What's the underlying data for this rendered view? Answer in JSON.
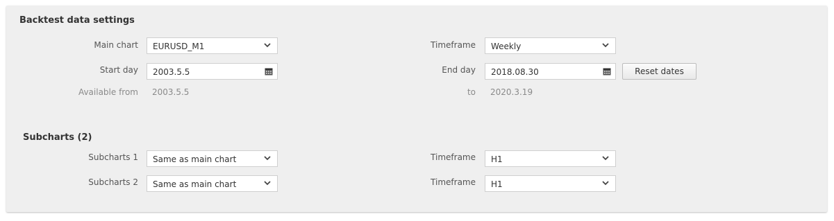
{
  "backtest": {
    "title": "Backtest data settings",
    "main_chart_label": "Main chart",
    "main_chart_value": "EURUSD_M1",
    "timeframe_label": "Timeframe",
    "timeframe_value": "Weekly",
    "start_day_label": "Start day",
    "start_day_value": "2003.5.5",
    "end_day_label": "End day",
    "end_day_value": "2018.08.30",
    "reset_dates_label": "Reset dates",
    "available_from_label": "Available from",
    "available_from_value": "2003.5.5",
    "to_label": "to",
    "to_value": "2020.3.19"
  },
  "subcharts": {
    "title": "Subcharts (2)",
    "rows": [
      {
        "label": "Subcharts 1",
        "value": "Same as main chart",
        "timeframe_label": "Timeframe",
        "timeframe_value": "H1"
      },
      {
        "label": "Subcharts 2",
        "value": "Same as main chart",
        "timeframe_label": "Timeframe",
        "timeframe_value": "H1"
      }
    ]
  },
  "icons": {
    "dropdown": "chevron-down-icon",
    "calendar": "calendar-icon"
  },
  "colors": {
    "panel_bg": "#efefef",
    "label_text": "#555555",
    "muted_text": "#8a8a8a"
  }
}
